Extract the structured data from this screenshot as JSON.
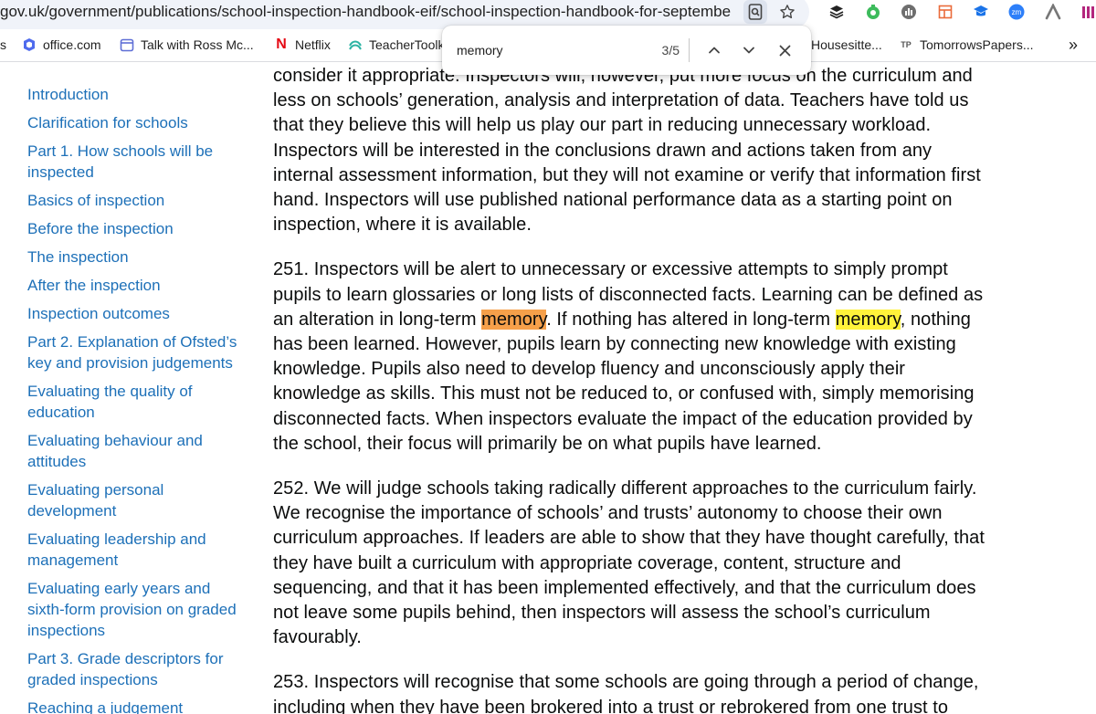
{
  "browser": {
    "url": "gov.uk/government/publications/school-inspection-handbook-eif/school-inspection-handbook-for-septembe...",
    "bookmarks": [
      {
        "label": "s",
        "icon": ""
      },
      {
        "label": "office.com",
        "icon": "office-icon"
      },
      {
        "label": "Talk with Ross Mc...",
        "icon": "calendar-icon"
      },
      {
        "label": "Netflix",
        "icon": "netflix-icon"
      },
      {
        "label": "TeacherToolk",
        "icon": "teachertoolkit-icon"
      },
      {
        "label": "Housesitte...",
        "icon": ""
      },
      {
        "label": "TomorrowsPapers...",
        "icon": "tomorrowspapers-icon"
      }
    ],
    "more_bookmarks": "»"
  },
  "find": {
    "query": "memory",
    "count": "3/5"
  },
  "sidebar": {
    "items": [
      "Introduction",
      "Clarification for schools",
      "Part 1. How schools will be inspected",
      "Basics of inspection",
      "Before the inspection",
      "The inspection",
      "After the inspection",
      "Inspection outcomes",
      "Part 2. Explanation of Ofsted’s key and provision judgements",
      "Evaluating the quality of education",
      "Evaluating behaviour and attitudes",
      "Evaluating personal development",
      "Evaluating leadership and management",
      "Evaluating early years and sixth-form provision on graded inspections",
      "Part 3. Grade descriptors for graded inspections",
      "Reaching a judgement"
    ]
  },
  "content": {
    "p0": "consider it appropriate. Inspectors will, however, put more focus on the curriculum and less on schools’ generation, analysis and interpretation of data. Teachers have told us that they believe this will help us play our part in reducing unnecessary workload. Inspectors will be interested in the conclusions drawn and actions taken from any internal assessment information, but they will not examine or verify that information first hand. Inspectors will use published national performance data as a starting point on inspection, where it is available.",
    "p251_a": "251. Inspectors will be alert to unnecessary or excessive attempts to simply prompt pupils to learn glossaries or long lists of disconnected facts. Learning can be defined as an alteration in long-term ",
    "p251_hl1": "memory",
    "p251_b": ". If nothing has altered in long-term ",
    "p251_hl2": "memory",
    "p251_c": ", nothing has been learned. However, pupils learn by connecting new knowledge with existing knowledge. Pupils also need to develop fluency and unconsciously apply their knowledge as skills. This must not be reduced to, or confused with, simply memorising disconnected facts. When inspectors evaluate the impact of the education provided by the school, their focus will primarily be on what pupils have learned.",
    "p252": "252. We will judge schools taking radically different approaches to the curriculum fairly. We recognise the importance of schools’ and trusts’ autonomy to choose their own curriculum approaches. If leaders are able to show that they have thought carefully, that they have built a curriculum with appropriate coverage, content, structure and sequencing, and that it has been implemented effectively, and that the curriculum does not leave some pupils behind, then inspectors will assess the school’s curriculum favourably.",
    "p253": "253. Inspectors will recognise that some schools are going through a period of change, including when they have been brokered into a trust or rebrokered from one trust to"
  }
}
